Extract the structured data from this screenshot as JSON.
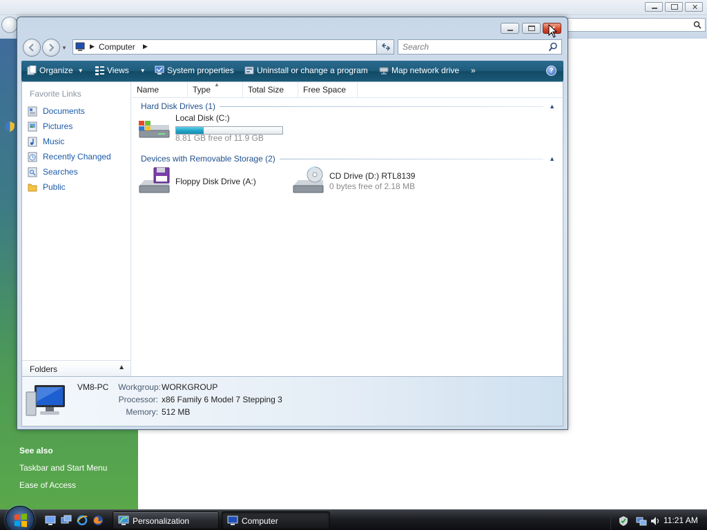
{
  "background_window": {
    "search_icon": "search-icon",
    "see_also": "See also",
    "links": [
      "Taskbar and Start Menu",
      "Ease of Access"
    ]
  },
  "window": {
    "title": "Computer",
    "address": {
      "location": "Computer"
    },
    "search": {
      "placeholder": "Search"
    },
    "toolbar": {
      "organize": "Organize",
      "views": "Views",
      "system_properties": "System properties",
      "uninstall": "Uninstall or change a program",
      "map_drive": "Map network drive",
      "more": "»"
    },
    "nav_pane": {
      "title": "Favorite Links",
      "items": [
        "Documents",
        "Pictures",
        "Music",
        "Recently Changed",
        "Searches",
        "Public"
      ],
      "folders_label": "Folders"
    },
    "columns": [
      "Name",
      "Type",
      "Total Size",
      "Free Space"
    ],
    "groups": [
      {
        "title": "Hard Disk Drives (1)",
        "drives": [
          {
            "name": "Local Disk (C:)",
            "free": "8.81 GB free of 11.9 GB",
            "used_fraction": 0.26
          }
        ]
      },
      {
        "title": "Devices with Removable Storage (2)",
        "drives": [
          {
            "name": "Floppy Disk Drive (A:)"
          },
          {
            "name": "CD Drive (D:) RTL8139",
            "free": "0 bytes free of 2.18 MB"
          }
        ]
      }
    ],
    "details": {
      "pc_name": "VM8-PC",
      "workgroup_label": "Workgroup:",
      "workgroup": "WORKGROUP",
      "processor_label": "Processor:",
      "processor": "x86 Family 6 Model 7 Stepping 3",
      "memory_label": "Memory:",
      "memory": "512 MB"
    }
  },
  "taskbar": {
    "tasks": [
      "Personalization",
      "Computer"
    ],
    "clock": "11:21 AM"
  }
}
